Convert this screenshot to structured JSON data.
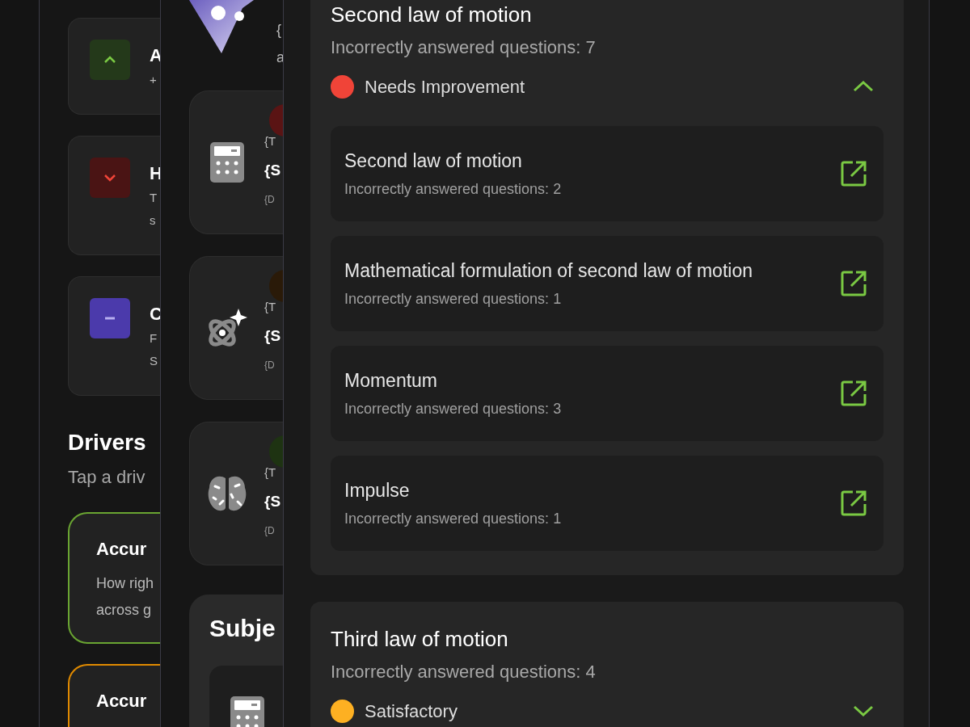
{
  "back_panel": {
    "trend_cards": [
      {
        "kind": "up",
        "title": "A",
        "lines": [
          "+"
        ]
      },
      {
        "kind": "down",
        "title": "H",
        "lines": [
          "T",
          "s"
        ]
      },
      {
        "kind": "flat",
        "title": "C",
        "lines": [
          "F",
          "S"
        ]
      }
    ],
    "drivers": {
      "title": "Drivers",
      "subtitle": "Tap a driv",
      "cards": [
        {
          "title": "Accur",
          "lines": [
            "How righ",
            "across g"
          ],
          "color": "#6aa532"
        },
        {
          "title": "Accur",
          "color": "#e08a00"
        }
      ]
    }
  },
  "middle_panel": {
    "intro": [
      "{",
      "a"
    ],
    "subject_cards": [
      {
        "kind": "calculator",
        "color": "#5a1414",
        "lines": [
          "{T",
          "{S",
          "{D"
        ]
      },
      {
        "kind": "atom",
        "color": "#2a1a08",
        "lines": [
          "{T",
          "{S",
          "{D"
        ]
      },
      {
        "kind": "brain",
        "color": "#1e3312",
        "lines": [
          "{T",
          "{S",
          "{D"
        ]
      }
    ],
    "subjects": {
      "title": "Subje",
      "items": [
        {
          "kind": "calculator"
        }
      ]
    }
  },
  "topics": [
    {
      "title": "Second law of motion",
      "summary": "Incorrectly answered questions: 7",
      "status": "Needs Improvement",
      "color": "#f04438",
      "expanded": true,
      "subtopics": [
        {
          "title": "Second law of motion",
          "summary": "Incorrectly answered questions: 2"
        },
        {
          "title": "Mathematical formulation of second law of motion",
          "summary": "Incorrectly answered questions: 1"
        },
        {
          "title": "Momentum",
          "summary": "Incorrectly answered questions: 3"
        },
        {
          "title": "Impulse",
          "summary": "Incorrectly answered questions: 1"
        }
      ]
    },
    {
      "title": "Third law of motion",
      "summary": "Incorrectly answered questions: 4",
      "status": "Satisfactory",
      "color": "#fdb022",
      "expanded": false
    }
  ]
}
